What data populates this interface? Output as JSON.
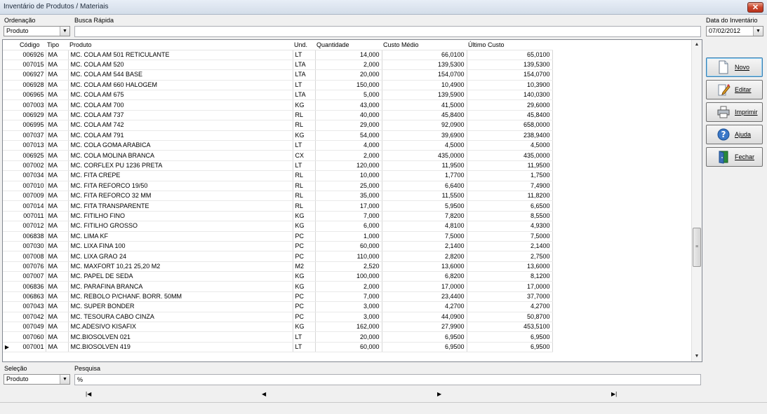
{
  "window": {
    "title": "Inventário de Produtos / Materiais",
    "close_glyph": "✕"
  },
  "ordenacao": {
    "label": "Ordenação",
    "value": "Produto"
  },
  "busca_rapida": {
    "label": "Busca Rápida",
    "value": ""
  },
  "data_inventario": {
    "label": "Data do Inventário",
    "value": "07/02/2012"
  },
  "table": {
    "columns": [
      "Código",
      "Tipo",
      "Produto",
      "Und.",
      "Quantidade",
      "Custo Médio",
      "Último Custo"
    ],
    "rows": [
      [
        "006926",
        "MA",
        "MC. COLA AM 501 RETICULANTE",
        "LT",
        "14,000",
        "66,0100",
        "65,0100"
      ],
      [
        "007015",
        "MA",
        "MC. COLA AM 520",
        "LTA",
        "2,000",
        "139,5300",
        "139,5300"
      ],
      [
        "006927",
        "MA",
        "MC. COLA AM 544 BASE",
        "LTA",
        "20,000",
        "154,0700",
        "154,0700"
      ],
      [
        "006928",
        "MA",
        "MC. COLA AM 660 HALOGEM",
        "LT",
        "150,000",
        "10,4900",
        "10,3900"
      ],
      [
        "006965",
        "MA",
        "MC. COLA AM 675",
        "LTA",
        "5,000",
        "139,5900",
        "140,0300"
      ],
      [
        "007003",
        "MA",
        "MC. COLA AM 700",
        "KG",
        "43,000",
        "41,5000",
        "29,6000"
      ],
      [
        "006929",
        "MA",
        "MC. COLA AM 737",
        "RL",
        "40,000",
        "45,8400",
        "45,8400"
      ],
      [
        "006995",
        "MA",
        "MC. COLA AM 742",
        "RL",
        "29,000",
        "92,0900",
        "658,0000"
      ],
      [
        "007037",
        "MA",
        "MC. COLA AM 791",
        "KG",
        "54,000",
        "39,6900",
        "238,9400"
      ],
      [
        "007013",
        "MA",
        "MC. COLA GOMA ARABICA",
        "LT",
        "4,000",
        "4,5000",
        "4,5000"
      ],
      [
        "006925",
        "MA",
        "MC. COLA MOLINA BRANCA",
        "CX",
        "2,000",
        "435,0000",
        "435,0000"
      ],
      [
        "007002",
        "MA",
        "MC. CORFLEX PU 1236 PRETA",
        "LT",
        "120,000",
        "11,9500",
        "11,9500"
      ],
      [
        "007034",
        "MA",
        "MC. FITA CREPE",
        "RL",
        "10,000",
        "1,7700",
        "1,7500"
      ],
      [
        "007010",
        "MA",
        "MC. FITA REFORCO 19/50",
        "RL",
        "25,000",
        "6,6400",
        "7,4900"
      ],
      [
        "007009",
        "MA",
        "MC. FITA REFORCO 32 MM",
        "RL",
        "35,000",
        "11,5500",
        "11,8200"
      ],
      [
        "007014",
        "MA",
        "MC. FITA TRANSPARENTE",
        "RL",
        "17,000",
        "5,9500",
        "6,6500"
      ],
      [
        "007011",
        "MA",
        "MC. FITILHO FINO",
        "KG",
        "7,000",
        "7,8200",
        "8,5500"
      ],
      [
        "007012",
        "MA",
        "MC. FITILHO GROSSO",
        "KG",
        "6,000",
        "4,8100",
        "4,9300"
      ],
      [
        "006838",
        "MA",
        "MC. LIMA KF",
        "PC",
        "1,000",
        "7,5000",
        "7,5000"
      ],
      [
        "007030",
        "MA",
        "MC. LIXA FINA 100",
        "PC",
        "60,000",
        "2,1400",
        "2,1400"
      ],
      [
        "007008",
        "MA",
        "MC. LIXA GRAO 24",
        "PC",
        "110,000",
        "2,8200",
        "2,7500"
      ],
      [
        "007076",
        "MA",
        "MC. MAXFORT 10,21 25,20 M2",
        "M2",
        "2,520",
        "13,6000",
        "13,6000"
      ],
      [
        "007007",
        "MA",
        "MC. PAPEL DE SEDA",
        "KG",
        "100,000",
        "6,8200",
        "8,1200"
      ],
      [
        "006836",
        "MA",
        "MC. PARAFINA BRANCA",
        "KG",
        "2,000",
        "17,0000",
        "17,0000"
      ],
      [
        "006863",
        "MA",
        "MC. REBOLO P/CHANF. BORR. 50MM",
        "PC",
        "7,000",
        "23,4400",
        "37,7000"
      ],
      [
        "007043",
        "MA",
        "MC. SUPER BONDER",
        "PC",
        "3,000",
        "4,2700",
        "4,2700"
      ],
      [
        "007042",
        "MA",
        "MC. TESOURA CABO CINZA",
        "PC",
        "3,000",
        "44,0900",
        "50,8700"
      ],
      [
        "007049",
        "MA",
        "MC.ADESIVO KISAFIX",
        "KG",
        "162,000",
        "27,9900",
        "453,5100"
      ],
      [
        "007060",
        "MA",
        "MC.BIOSOLVEN 021",
        "LT",
        "20,000",
        "6,9500",
        "6,9500"
      ],
      [
        "007001",
        "MA",
        "MC.BIOSOLVEN 419",
        "LT",
        "60,000",
        "6,9500",
        "6,9500"
      ]
    ],
    "current_row_indicator": "▶",
    "scroll_up_glyph": "▲",
    "scroll_down_glyph": "▼",
    "scroll_thumb_glyph": "≡"
  },
  "buttons": {
    "novo": "Novo",
    "editar": "Editar",
    "imprimir": "Imprimir",
    "ajuda": "Ajuda",
    "fechar": "Fechar"
  },
  "selecao": {
    "label": "Seleção",
    "value": "Produto"
  },
  "pesquisa": {
    "label": "Pesquisa",
    "value": "%"
  },
  "navigator": {
    "first": "|◀",
    "prev": "◀",
    "next": "▶",
    "last": "▶|"
  },
  "colors": {
    "title_text": "#1e2b3c",
    "close_red": "#c9452c",
    "default_button_border": "#3c7fb1"
  }
}
